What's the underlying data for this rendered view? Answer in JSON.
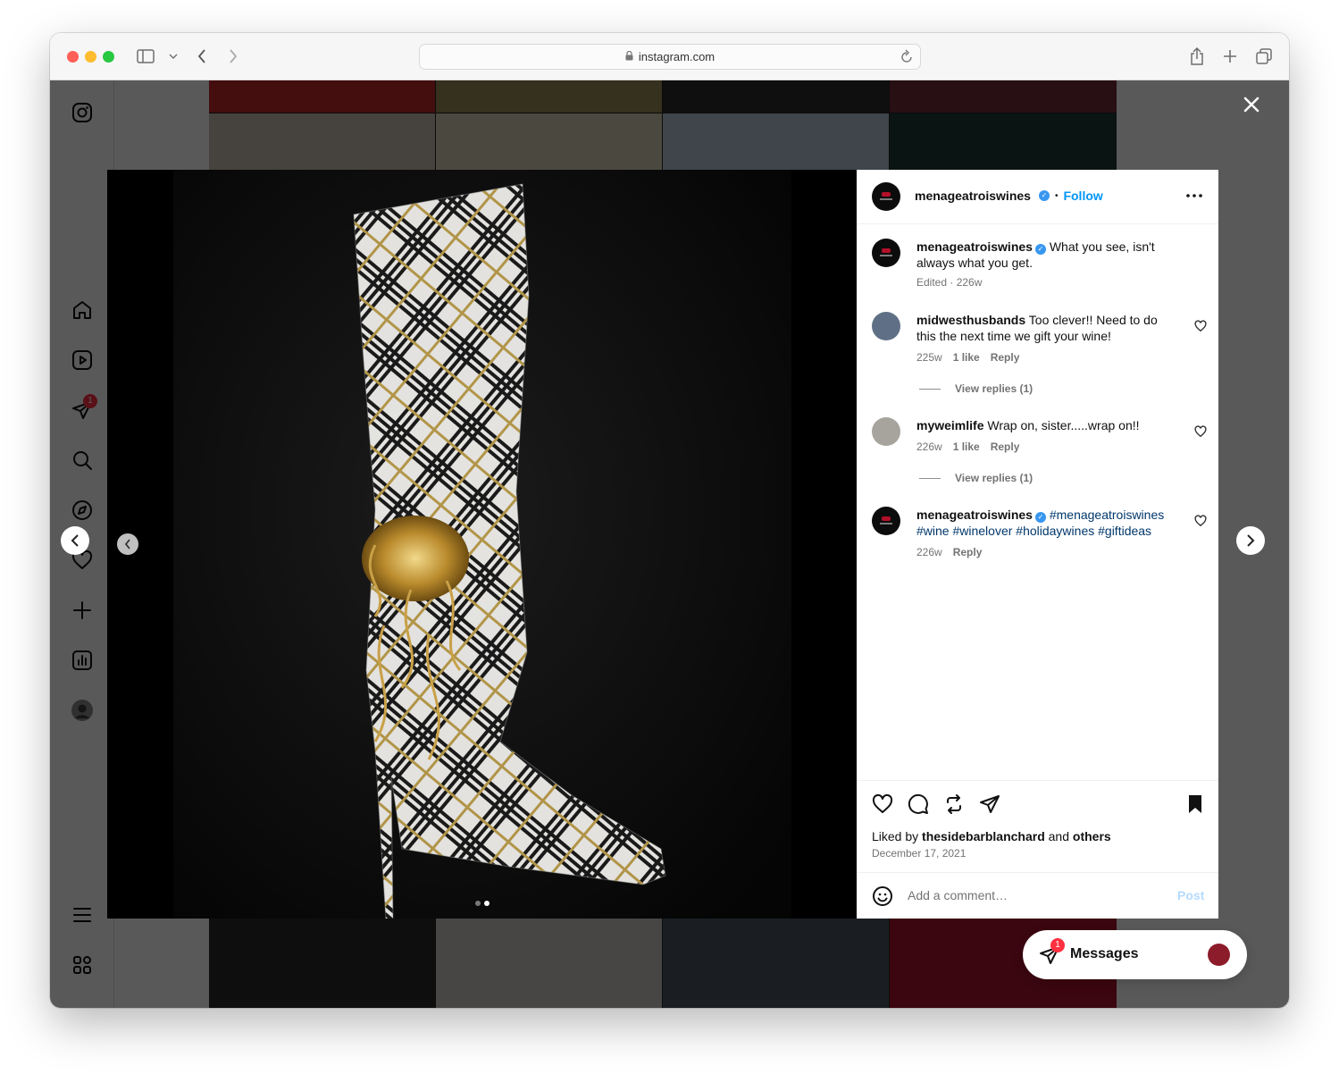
{
  "browser": {
    "url": "instagram.com",
    "traffic_colors": [
      "#ff5f57",
      "#febc2e",
      "#28c840"
    ]
  },
  "sidebar": {
    "icons": [
      "instagram-icon",
      "home-icon",
      "reels-icon",
      "direct-icon",
      "search-icon",
      "explore-icon",
      "heart-icon",
      "create-icon",
      "dashboard-icon",
      "profile-avatar",
      "menu-icon",
      "more-icon"
    ],
    "direct_badge": "1"
  },
  "post": {
    "author": "menageatroiswines",
    "follow_label": "Follow",
    "dot_separator": "•",
    "caption": "What you see, isn't always what you get.",
    "caption_meta": "Edited · 226w",
    "comments": [
      {
        "user": "midwesthusbands",
        "text": "Too clever!! Need to do this the next time we gift your wine!",
        "age": "225w",
        "likes": "1 like",
        "reply": "Reply",
        "view_replies": "View replies (1)"
      },
      {
        "user": "myweimlife",
        "text": "Wrap on, sister.....wrap on!!",
        "age": "226w",
        "likes": "1 like",
        "reply": "Reply",
        "view_replies": "View replies (1)"
      },
      {
        "user": "menageatroiswines",
        "hashtags": "#menageatroiswines #wine #winelover #holidaywines #giftideas",
        "age": "226w",
        "reply": "Reply"
      }
    ],
    "liked_by_prefix": "Liked by",
    "liked_by_user": "thesidebarblanchard",
    "liked_by_and": "and",
    "liked_by_others": "others",
    "date": "December 17, 2021",
    "add_comment_placeholder": "Add a comment…",
    "post_label": "Post"
  },
  "messages": {
    "label": "Messages",
    "badge": "1"
  }
}
